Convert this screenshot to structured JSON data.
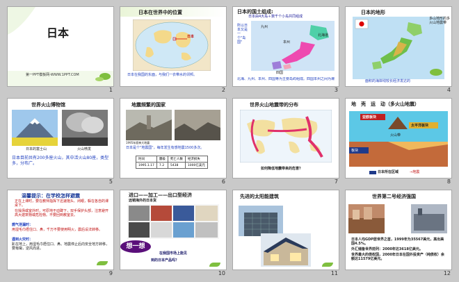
{
  "slides": [
    {
      "num": "1",
      "title": "日本",
      "footer": "第一PPT模板网-WWW.1PPT.COM"
    },
    {
      "num": "2",
      "title": "日本在世界中的位置",
      "map_label": "日本",
      "note": "日本在我国的东面，与我们一衣带水的邻邦。"
    },
    {
      "num": "3",
      "title": "日本的国土组成:",
      "subtitle": "日本由4大岛＋数千个小岛共同组成",
      "side": "所以日本又是一个\"岛国\"",
      "islands": [
        "九州",
        "本州",
        "北海道",
        "四国"
      ],
      "note": "北海、九州、本州、四国等为主要岛屿组成。四国本州之间为濑户"
    },
    {
      "num": "4",
      "title": "日本的地形",
      "right": "多山地形的多火山地震带",
      "note": "面积的海岸线较长经济发达的"
    },
    {
      "num": "5",
      "title": "世界火山博物馆",
      "cap1": "日本的富士山",
      "cap2": "火山喷发",
      "note": "日本目前共有200多座火山，其中活火山80座，类型多，分布广。"
    },
    {
      "num": "6",
      "title": "地震频繁的国家",
      "cap": "1995年阪神大地震",
      "note": "日本是个\"地震国\"，每年发生有感地震1500多次。",
      "table_headers": [
        "时间",
        "震级",
        "死亡人数",
        "经济损失"
      ],
      "table_row": [
        "1995.1.17",
        "7.2",
        "5438",
        "1000亿美元"
      ]
    },
    {
      "num": "7",
      "title": "世界火山地震带的分布",
      "question": "如何降低地震带来的危害？"
    },
    {
      "num": "8",
      "title": "地　壳　运　动（多火山地震）",
      "labels": [
        "亚欧板块",
        "太平洋板块",
        "火山带",
        "板块",
        "日本所在区域"
      ],
      "legend": "日本所在区域",
      "legend2": "→地震"
    },
    {
      "num": "9",
      "title": "温馨提示：在学校怎样避震",
      "p1": "正在上课时，要在教师指挥下迅速抱头、闭眼，躲在各自的课桌下。",
      "p2": "在操场或室外时，可原地不动蹲下，双手保护头部，注意避开高大建筑物或危险物。不要回到教室去。",
      "p3": "燃气泄漏时：",
      "p4": "用湿毛巾捂住口、鼻，千万不要使用明火，震后设法转移。",
      "p5": "遇到火灾时：",
      "p6": "趴在地上，用湿毛巾捂住口、鼻。地震停止后向安全地方转移，要匍匐，逆风而进。"
    },
    {
      "num": "10",
      "title": "进口——加工——出口型经济",
      "sub": "远销海外的日本货",
      "think": "想一想",
      "q1": "在我国市场上能见",
      "q2": "到的日本产品吗？"
    },
    {
      "num": "11",
      "title": "先进的太阳能建筑"
    },
    {
      "num": "12",
      "title": "世界第二号经济强国",
      "facts": [
        "日本人均GDP居世界之首，1999年为35567美元，高出美国4.5%。",
        "外汇储备世界前列：2000年达3618亿美元。",
        "世界最大的债权国，2000年日本在国外投资产（纯债权）余额达11579亿美元。"
      ]
    }
  ]
}
